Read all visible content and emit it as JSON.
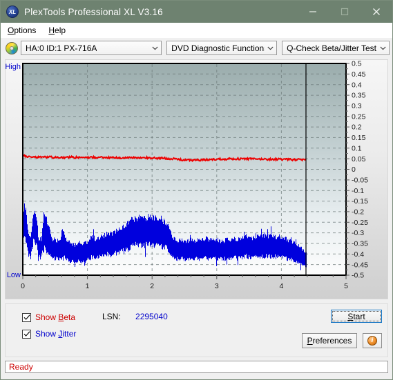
{
  "window": {
    "title": "PlexTools Professional XL V3.16",
    "app_icon": "XL",
    "minimize_label": "Minimize",
    "maximize_label": "Maximize",
    "close_label": "Close",
    "titlebar_color": "#6e8270"
  },
  "menubar": {
    "items": [
      {
        "label": "Options",
        "accel": "O"
      },
      {
        "label": "Help",
        "accel": "H"
      }
    ]
  },
  "toolbar": {
    "drive_icon": "disc-icon",
    "drive_select": {
      "value": "HA:0 ID:1  PX-716A"
    },
    "function_select": {
      "value": "DVD Diagnostic Functions"
    },
    "test_select": {
      "value": "Q-Check Beta/Jitter Test"
    }
  },
  "controls": {
    "show_beta": {
      "label": "Show Beta",
      "accel": "B",
      "checked": true,
      "color": "#cc0000"
    },
    "show_jitter": {
      "label": "Show Jitter",
      "accel": "J",
      "checked": true,
      "color": "#0000cc"
    },
    "lsn_label": "LSN:",
    "lsn_value": "2295040",
    "start_button": "Start",
    "start_accel": "S",
    "preferences_button": "Preferences",
    "preferences_accel": "P",
    "info_button": "i"
  },
  "statusbar": {
    "text": "Ready",
    "color": "#cc0000"
  },
  "chart_data": {
    "type": "line",
    "title": "Q-Check Beta/Jitter Test",
    "xlabel": "",
    "ylabel": "",
    "ylim": [
      -0.5,
      0.5
    ],
    "xlim": [
      0,
      5
    ],
    "grid": true,
    "legend_position": "below-left",
    "y_axis_left_top_label": "High",
    "y_axis_left_bottom_label": "Low",
    "ytick_labels": [
      "0.5",
      "0.45",
      "0.4",
      "0.35",
      "0.3",
      "0.25",
      "0.2",
      "0.15",
      "0.1",
      "0.05",
      "0",
      "-0.05",
      "-0.1",
      "-0.15",
      "-0.2",
      "-0.25",
      "-0.3",
      "-0.35",
      "-0.4",
      "-0.45",
      "-0.5"
    ],
    "ytick_values": [
      0.5,
      0.45,
      0.4,
      0.35,
      0.3,
      0.25,
      0.2,
      0.15,
      0.1,
      0.05,
      0,
      -0.05,
      -0.1,
      -0.15,
      -0.2,
      -0.25,
      -0.3,
      -0.35,
      -0.4,
      -0.45,
      -0.5
    ],
    "xtick_labels": [
      "0",
      "1",
      "2",
      "3",
      "4",
      "5"
    ],
    "xtick_values": [
      0,
      1,
      2,
      3,
      4,
      5
    ],
    "data_end_marker_x": 4.38,
    "series": [
      {
        "name": "Beta",
        "color": "#ee0000",
        "x": [
          0.0,
          0.05,
          0.1,
          0.15,
          0.2,
          0.25,
          0.3,
          0.35,
          0.4,
          0.45,
          0.5,
          0.55,
          0.6,
          0.65,
          0.7,
          0.75,
          0.8,
          0.85,
          0.9,
          0.95,
          1.0,
          1.05,
          1.1,
          1.15,
          1.2,
          1.25,
          1.3,
          1.35,
          1.4,
          1.45,
          1.5,
          1.55,
          1.6,
          1.65,
          1.7,
          1.75,
          1.8,
          1.85,
          1.9,
          1.95,
          2.0,
          2.05,
          2.1,
          2.15,
          2.2,
          2.25,
          2.3,
          2.35,
          2.4,
          2.45,
          2.5,
          2.55,
          2.6,
          2.65,
          2.7,
          2.75,
          2.8,
          2.85,
          2.9,
          2.95,
          3.0,
          3.05,
          3.1,
          3.15,
          3.2,
          3.25,
          3.3,
          3.35,
          3.4,
          3.45,
          3.5,
          3.55,
          3.6,
          3.65,
          3.7,
          3.75,
          3.8,
          3.85,
          3.9,
          3.95,
          4.0,
          4.05,
          4.1,
          4.15,
          4.2,
          4.25,
          4.3,
          4.35,
          4.38
        ],
        "y": [
          0.066,
          0.06,
          0.058,
          0.059,
          0.057,
          0.058,
          0.059,
          0.057,
          0.058,
          0.057,
          0.056,
          0.057,
          0.058,
          0.056,
          0.057,
          0.058,
          0.056,
          0.057,
          0.056,
          0.057,
          0.055,
          0.056,
          0.057,
          0.055,
          0.056,
          0.055,
          0.056,
          0.054,
          0.055,
          0.056,
          0.054,
          0.055,
          0.054,
          0.055,
          0.054,
          0.055,
          0.053,
          0.054,
          0.055,
          0.053,
          0.054,
          0.053,
          0.052,
          0.053,
          0.052,
          0.051,
          0.05,
          0.049,
          0.047,
          0.045,
          0.044,
          0.043,
          0.044,
          0.043,
          0.044,
          0.043,
          0.044,
          0.045,
          0.046,
          0.047,
          0.048,
          0.049,
          0.048,
          0.049,
          0.05,
          0.049,
          0.05,
          0.049,
          0.05,
          0.049,
          0.05,
          0.049,
          0.048,
          0.048,
          0.049,
          0.048,
          0.047,
          0.048,
          0.047,
          0.048,
          0.047,
          0.046,
          0.047,
          0.046,
          0.045,
          0.046,
          0.045,
          0.044,
          0.043
        ]
      },
      {
        "name": "Jitter",
        "color": "#0000dd",
        "note": "Plotted as a noise band; upper and lower envelope values.",
        "x": [
          0.0,
          0.04,
          0.08,
          0.12,
          0.16,
          0.2,
          0.24,
          0.28,
          0.32,
          0.36,
          0.4,
          0.44,
          0.48,
          0.52,
          0.56,
          0.6,
          0.64,
          0.68,
          0.72,
          0.76,
          0.8,
          0.84,
          0.88,
          0.92,
          0.96,
          1.0,
          1.04,
          1.08,
          1.12,
          1.16,
          1.2,
          1.24,
          1.28,
          1.32,
          1.36,
          1.4,
          1.44,
          1.48,
          1.52,
          1.56,
          1.6,
          1.64,
          1.68,
          1.72,
          1.76,
          1.8,
          1.84,
          1.88,
          1.92,
          1.96,
          2.0,
          2.04,
          2.08,
          2.12,
          2.16,
          2.2,
          2.24,
          2.28,
          2.32,
          2.36,
          2.4,
          2.44,
          2.48,
          2.52,
          2.56,
          2.6,
          2.64,
          2.68,
          2.72,
          2.76,
          2.8,
          2.84,
          2.88,
          2.92,
          2.96,
          3.0,
          3.04,
          3.08,
          3.12,
          3.16,
          3.2,
          3.24,
          3.28,
          3.32,
          3.36,
          3.4,
          3.44,
          3.48,
          3.52,
          3.56,
          3.6,
          3.64,
          3.68,
          3.72,
          3.76,
          3.8,
          3.84,
          3.88,
          3.92,
          3.96,
          4.0,
          4.04,
          4.08,
          4.12,
          4.16,
          4.2,
          4.24,
          4.28,
          4.32,
          4.36,
          4.38
        ],
        "upper": [
          -0.19,
          -0.195,
          -0.3,
          -0.32,
          -0.205,
          -0.21,
          -0.33,
          -0.335,
          -0.225,
          -0.245,
          -0.265,
          -0.33,
          -0.335,
          -0.34,
          -0.345,
          -0.3,
          -0.31,
          -0.34,
          -0.35,
          -0.355,
          -0.36,
          -0.355,
          -0.35,
          -0.355,
          -0.35,
          -0.345,
          -0.33,
          -0.32,
          -0.335,
          -0.33,
          -0.325,
          -0.32,
          -0.31,
          -0.3,
          -0.31,
          -0.305,
          -0.295,
          -0.285,
          -0.28,
          -0.275,
          -0.265,
          -0.255,
          -0.245,
          -0.24,
          -0.235,
          -0.23,
          -0.235,
          -0.24,
          -0.23,
          -0.225,
          -0.23,
          -0.24,
          -0.235,
          -0.23,
          -0.25,
          -0.255,
          -0.26,
          -0.3,
          -0.33,
          -0.335,
          -0.34,
          -0.335,
          -0.34,
          -0.345,
          -0.34,
          -0.335,
          -0.345,
          -0.34,
          -0.335,
          -0.34,
          -0.335,
          -0.33,
          -0.34,
          -0.335,
          -0.34,
          -0.335,
          -0.34,
          -0.345,
          -0.34,
          -0.335,
          -0.34,
          -0.335,
          -0.33,
          -0.335,
          -0.33,
          -0.325,
          -0.315,
          -0.32,
          -0.325,
          -0.33,
          -0.325,
          -0.32,
          -0.315,
          -0.32,
          -0.315,
          -0.32,
          -0.315,
          -0.32,
          -0.325,
          -0.32,
          -0.325,
          -0.33,
          -0.335,
          -0.34,
          -0.345,
          -0.35,
          -0.36,
          -0.37,
          -0.38,
          -0.39,
          -0.4
        ],
        "lower": [
          -0.3,
          -0.33,
          -0.4,
          -0.41,
          -0.33,
          -0.34,
          -0.41,
          -0.415,
          -0.36,
          -0.38,
          -0.395,
          -0.41,
          -0.415,
          -0.42,
          -0.425,
          -0.41,
          -0.415,
          -0.42,
          -0.43,
          -0.432,
          -0.435,
          -0.432,
          -0.43,
          -0.432,
          -0.43,
          -0.425,
          -0.415,
          -0.41,
          -0.415,
          -0.412,
          -0.408,
          -0.405,
          -0.4,
          -0.395,
          -0.4,
          -0.398,
          -0.392,
          -0.388,
          -0.385,
          -0.38,
          -0.375,
          -0.368,
          -0.36,
          -0.355,
          -0.352,
          -0.35,
          -0.353,
          -0.356,
          -0.35,
          -0.346,
          -0.35,
          -0.356,
          -0.352,
          -0.348,
          -0.36,
          -0.365,
          -0.37,
          -0.4,
          -0.415,
          -0.418,
          -0.42,
          -0.418,
          -0.42,
          -0.422,
          -0.42,
          -0.418,
          -0.422,
          -0.42,
          -0.418,
          -0.42,
          -0.418,
          -0.415,
          -0.42,
          -0.418,
          -0.42,
          -0.418,
          -0.42,
          -0.422,
          -0.42,
          -0.418,
          -0.42,
          -0.418,
          -0.415,
          -0.418,
          -0.415,
          -0.412,
          -0.406,
          -0.41,
          -0.412,
          -0.415,
          -0.412,
          -0.408,
          -0.405,
          -0.408,
          -0.405,
          -0.408,
          -0.405,
          -0.408,
          -0.412,
          -0.408,
          -0.412,
          -0.415,
          -0.418,
          -0.42,
          -0.424,
          -0.428,
          -0.435,
          -0.442,
          -0.45,
          -0.458,
          -0.465
        ]
      }
    ]
  }
}
